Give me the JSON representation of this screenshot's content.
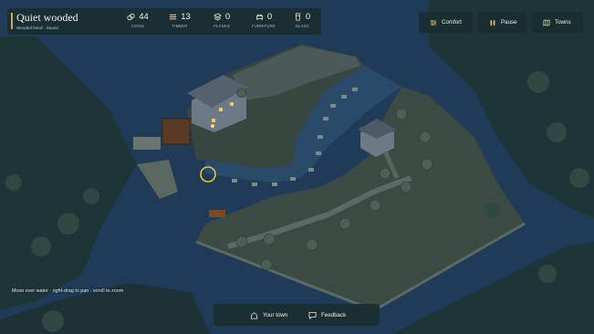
{
  "town": {
    "name": "Quiet wooded",
    "subtitle": "Wooded bend · Saved"
  },
  "resources": [
    {
      "icon": "coins-icon",
      "value": "44",
      "label": "COINS"
    },
    {
      "icon": "timber-icon",
      "value": "13",
      "label": "TIMBER"
    },
    {
      "icon": "planks-icon",
      "value": "0",
      "label": "PLANKS"
    },
    {
      "icon": "furniture-icon",
      "value": "0",
      "label": "FURNITURE"
    },
    {
      "icon": "glass-icon",
      "value": "0",
      "label": "GLASS"
    }
  ],
  "top_buttons": {
    "comfort": "Comfort",
    "pause": "Pause",
    "towns": "Towns"
  },
  "hint": "Move over water · right-drag to pan · scroll to zoom",
  "bottom_bar": {
    "your_town": "Your town",
    "feedback": "Feedback"
  },
  "colors": {
    "panel": "#1a2e30",
    "water": "#1f3b58",
    "land": "#3b4a43",
    "accent": "#c9a85a",
    "cursor": "#e8c53a"
  }
}
